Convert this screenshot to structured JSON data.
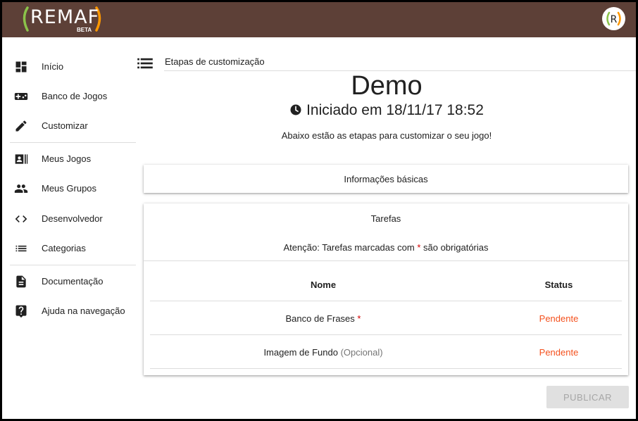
{
  "app": {
    "logo_text": "REMAF",
    "logo_badge": "BETA",
    "avatar_letter": "R"
  },
  "sidebar": {
    "items": [
      {
        "label": "Início",
        "icon": "dashboard-icon"
      },
      {
        "label": "Banco de Jogos",
        "icon": "gamepad-icon"
      },
      {
        "label": "Customizar",
        "icon": "pencil-icon"
      },
      {
        "label": "Meus Jogos",
        "icon": "contact-list-icon"
      },
      {
        "label": "Meus Grupos",
        "icon": "people-icon"
      },
      {
        "label": "Desenvolvedor",
        "icon": "code-icon"
      },
      {
        "label": "Categorias",
        "icon": "list-icon"
      },
      {
        "label": "Documentação",
        "icon": "document-icon"
      },
      {
        "label": "Ajuda na navegação",
        "icon": "help-icon"
      }
    ]
  },
  "header": {
    "title": "Etapas de customização"
  },
  "main": {
    "game_title": "Demo",
    "started_text": "Iniciado em 18/11/17 18:52",
    "intro": "Abaixo estão as etapas para customizar o seu jogo!",
    "basic_info_title": "Informações básicas",
    "tasks": {
      "title": "Tarefas",
      "warning_prefix": "Atenção: Tarefas marcadas com",
      "required_mark": "*",
      "warning_suffix": "são obrigatórias",
      "columns": {
        "name": "Nome",
        "status": "Status"
      },
      "rows": [
        {
          "name": "Banco de Frases",
          "marker": "*",
          "status": "Pendente"
        },
        {
          "name": "Imagem de Fundo",
          "marker": "(Opcional)",
          "status": "Pendente"
        }
      ]
    },
    "publish_label": "PUBLICAR"
  },
  "colors": {
    "topbar": "#5d4037",
    "logo_green": "#8bc34a",
    "logo_orange": "#ff9800",
    "status_pending": "#f4511e",
    "required": "#d50000"
  }
}
